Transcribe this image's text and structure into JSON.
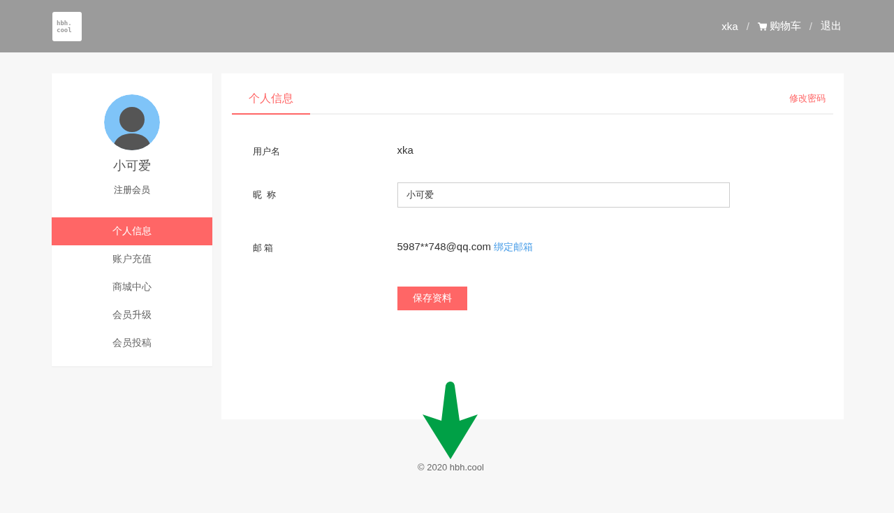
{
  "header": {
    "logo": [
      "hbh.",
      "cool"
    ],
    "nav": [
      {
        "kind": "user",
        "label": "xka"
      },
      {
        "kind": "separator",
        "label": "/"
      },
      {
        "kind": "cart",
        "label": "购物车"
      },
      {
        "kind": "separator",
        "label": "/"
      },
      {
        "kind": "logout",
        "label": "退出"
      }
    ]
  },
  "sidebar": {
    "name": "小可爱",
    "role": "注册会员",
    "items": [
      {
        "label": "个人信息",
        "selected": true
      },
      {
        "label": "账户充值",
        "selected": false
      },
      {
        "label": "商城中心",
        "selected": false
      },
      {
        "label": "会员升级",
        "selected": false
      },
      {
        "label": "会员投稿",
        "selected": false
      }
    ]
  },
  "panel": {
    "tabs": [
      {
        "label": "个人信息",
        "selected": true
      }
    ],
    "action_link": "修改密码",
    "rows": [
      {
        "kind": "text",
        "label": "用户名",
        "value": "xka"
      },
      {
        "kind": "input",
        "label": "昵  称",
        "value": "小可爱"
      },
      {
        "kind": "email",
        "label": "邮 箱",
        "value": "5987**748@qq.com",
        "link": "绑定邮箱"
      },
      {
        "kind": "button",
        "label": "保存资料"
      }
    ]
  },
  "footer": "© 2020 hbh.cool"
}
